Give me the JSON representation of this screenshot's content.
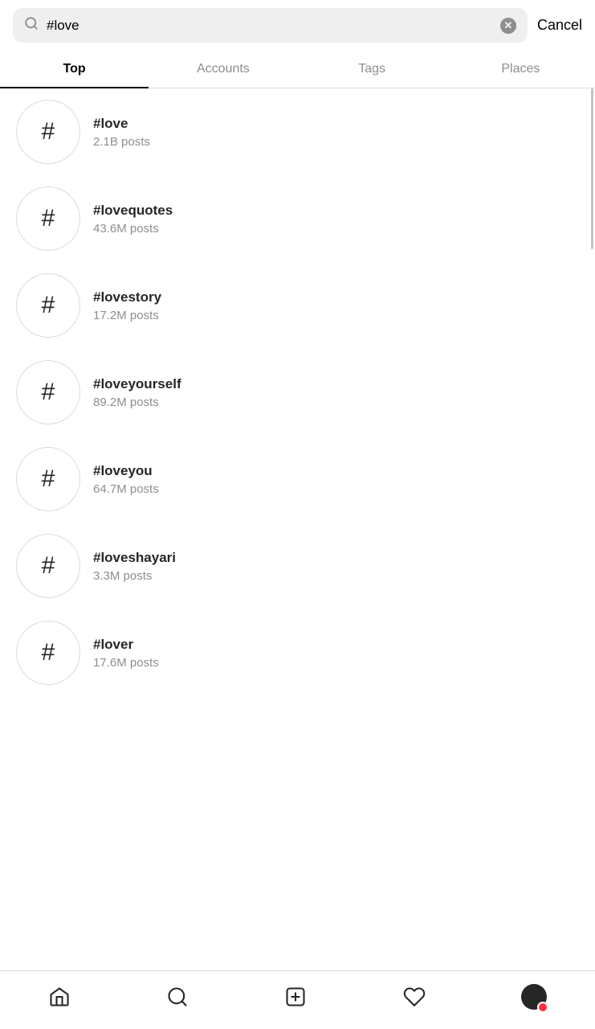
{
  "search": {
    "query": "#love",
    "placeholder": "Search",
    "clear_label": "×",
    "cancel_label": "Cancel"
  },
  "tabs": [
    {
      "id": "top",
      "label": "Top",
      "active": true
    },
    {
      "id": "accounts",
      "label": "Accounts",
      "active": false
    },
    {
      "id": "tags",
      "label": "Tags",
      "active": false
    },
    {
      "id": "places",
      "label": "Places",
      "active": false
    }
  ],
  "hashtags": [
    {
      "tag": "#love",
      "posts": "2.1B posts"
    },
    {
      "tag": "#lovequotes",
      "posts": "43.6M posts"
    },
    {
      "tag": "#lovestory",
      "posts": "17.2M posts"
    },
    {
      "tag": "#loveyourself",
      "posts": "89.2M posts"
    },
    {
      "tag": "#loveyou",
      "posts": "64.7M posts"
    },
    {
      "tag": "#loveshayari",
      "posts": "3.3M posts"
    },
    {
      "tag": "#lover",
      "posts": "17.6M posts"
    }
  ],
  "bottom_nav": {
    "home_label": "Home",
    "search_label": "Search",
    "add_label": "Add",
    "activity_label": "Activity",
    "profile_label": "Profile"
  }
}
